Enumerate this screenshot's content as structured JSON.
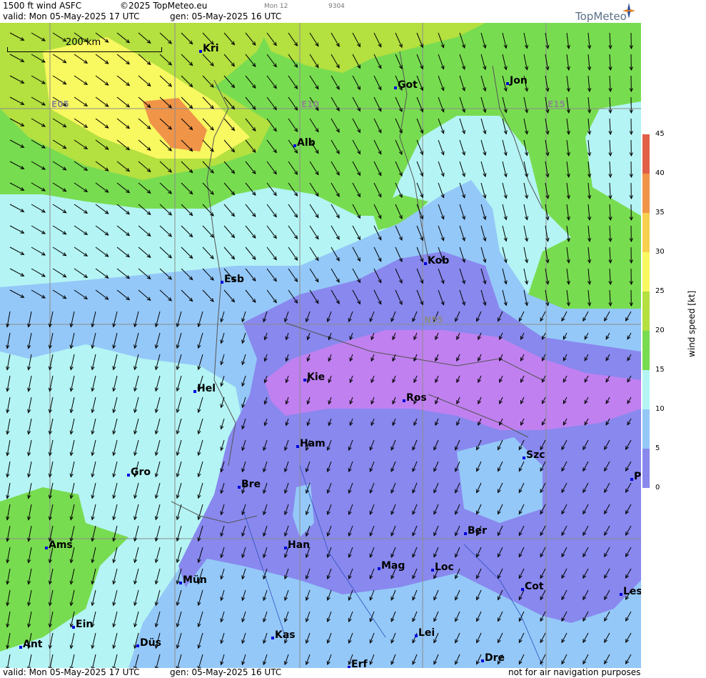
{
  "header": {
    "title": "1500 ft wind ASFC",
    "copyright": "©2025 TopMeteo.eu",
    "model_tag": "Mon 12",
    "code": "9304",
    "valid": "valid:  Mon  05-May-2025  17 UTC",
    "generated": "gen: 05-May-2025 16 UTC",
    "brand": "TopMeteo"
  },
  "map": {
    "scale_label": "200 km",
    "grid_labels": [
      "E05",
      "E10",
      "E15",
      "N55"
    ],
    "cities": [
      "Kri",
      "Got",
      "Jon",
      "Alb",
      "Esb",
      "Kob",
      "Kie",
      "Hel",
      "Ros",
      "Ham",
      "Szc",
      "Gro",
      "Bre",
      "P",
      "Ber",
      "Ams",
      "Han",
      "Mag",
      "Loc",
      "Mün",
      "Cot",
      "Les",
      "Ein",
      "Kas",
      "Lei",
      "Ant",
      "Düs",
      "Dre",
      "Erf"
    ]
  },
  "legend": {
    "title": "wind speed [kt]",
    "ticks": [
      "45",
      "40",
      "35",
      "30",
      "25",
      "20",
      "15",
      "10",
      "5",
      "0"
    ],
    "colors": [
      "#e06048",
      "#f09448",
      "#f8d050",
      "#f8f860",
      "#b4e040",
      "#78dc50",
      "#b4f4f4",
      "#94c8f8",
      "#8888ee",
      "#c080f0"
    ]
  },
  "footer": {
    "valid": "valid:  Mon  05-May-2025  17 UTC",
    "generated": "gen: 05-May-2025 16 UTC",
    "disclaimer": "not for air navigation purposes"
  }
}
